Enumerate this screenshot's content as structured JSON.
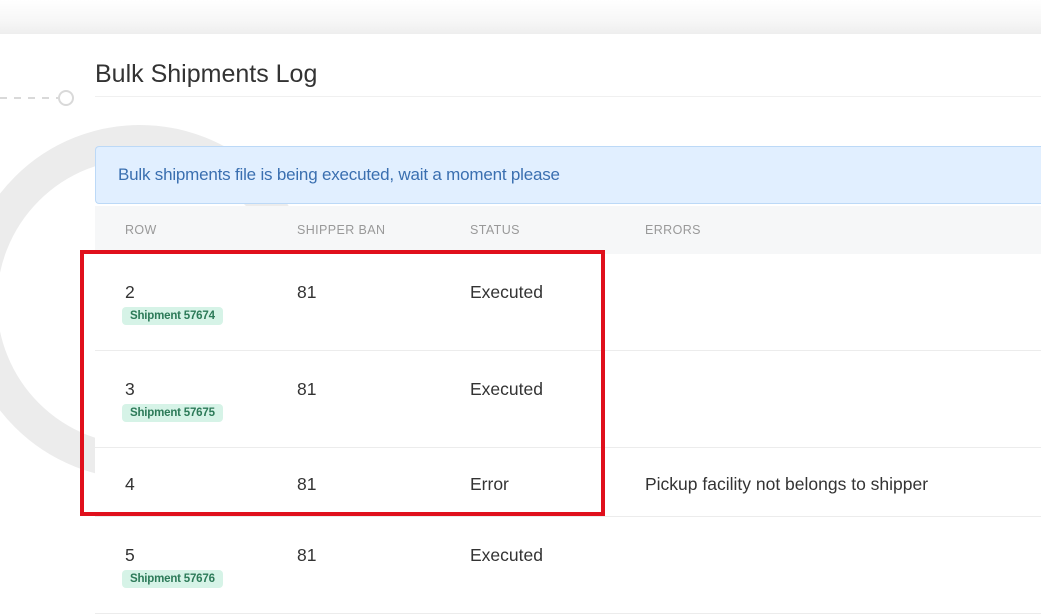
{
  "page": {
    "title": "Bulk Shipments Log"
  },
  "alert": {
    "message": "Bulk shipments file is being executed, wait a moment please"
  },
  "table": {
    "headers": {
      "row": "ROW",
      "shipper_ban": "SHIPPER BAN",
      "status": "STATUS",
      "errors": "ERRORS"
    },
    "rows": [
      {
        "row": "2",
        "shipper_ban": "81",
        "status": "Executed",
        "errors": "",
        "shipment": "Shipment 57674"
      },
      {
        "row": "3",
        "shipper_ban": "81",
        "status": "Executed",
        "errors": "",
        "shipment": "Shipment 57675"
      },
      {
        "row": "4",
        "shipper_ban": "81",
        "status": "Error",
        "errors": "Pickup facility not belongs to shipper",
        "shipment": ""
      },
      {
        "row": "5",
        "shipper_ban": "81",
        "status": "Executed",
        "errors": "",
        "shipment": "Shipment 57676"
      }
    ]
  },
  "colors": {
    "alert_background": "#e1efff",
    "alert_text": "#3a6fb0",
    "tag_background": "#d6f3e7",
    "tag_text": "#2c7a58",
    "highlight": "#e0101c"
  }
}
